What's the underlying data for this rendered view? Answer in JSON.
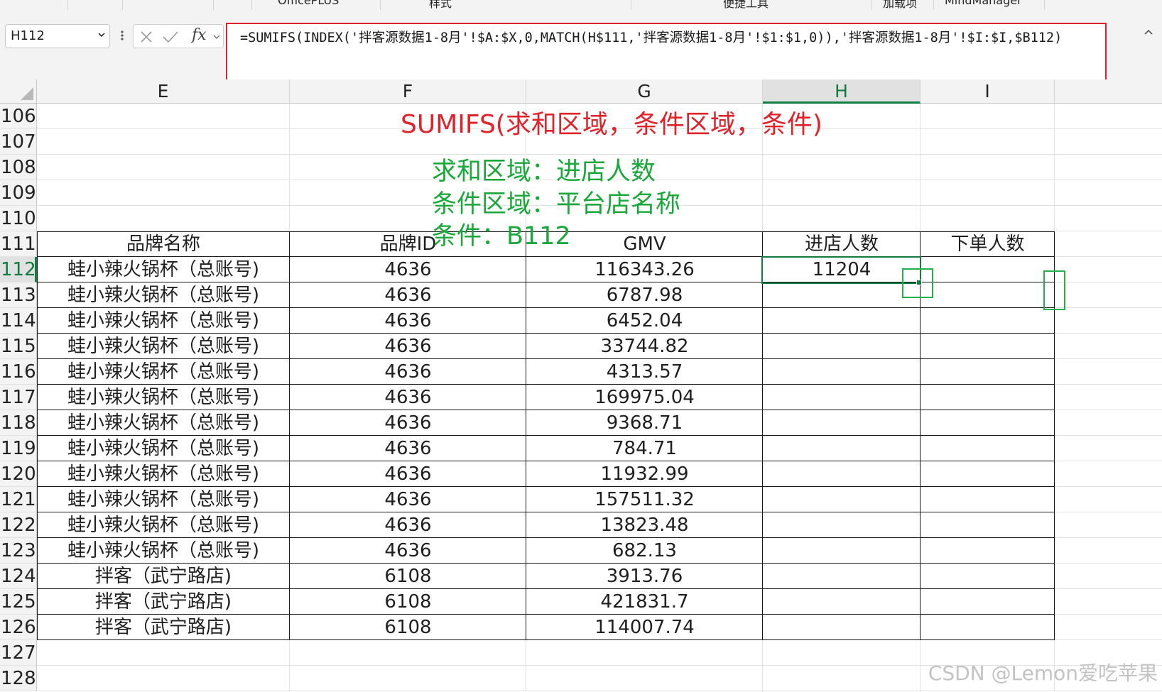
{
  "ribbon": {
    "items": [
      "OfficePLUS",
      "样式",
      "便捷工具",
      "加载项",
      "MindManager"
    ]
  },
  "formula_bar": {
    "name_box": "H112",
    "fx_label": "fx",
    "formula": "=SUMIFS(INDEX('拌客源数据1-8月'!$A:$X,0,MATCH(H$111,'拌客源数据1-8月'!$1:$1,0)),'拌客源数据1-8月'!$I:$I,$B112)"
  },
  "columns": [
    "E",
    "F",
    "G",
    "H",
    "I"
  ],
  "active_column": "H",
  "rows": [
    "106",
    "107",
    "108",
    "109",
    "110",
    "111",
    "112",
    "113",
    "114",
    "115",
    "116",
    "117",
    "118",
    "119",
    "120",
    "121",
    "122",
    "123",
    "124",
    "125",
    "126",
    "127",
    "128"
  ],
  "active_row": "112",
  "annotations": {
    "syntax": "SUMIFS(求和区域，条件区域，条件)",
    "sum_range": "求和区域：进店人数",
    "criteria_range": "条件区域：平台店名称",
    "criteria": "条件：B112"
  },
  "table": {
    "headers": [
      "品牌名称",
      "品牌ID",
      "GMV",
      "进店人数",
      "下单人数"
    ],
    "rows": [
      [
        "蛙小辣火锅杯（总账号)",
        "4636",
        "116343.26",
        "11204",
        ""
      ],
      [
        "蛙小辣火锅杯（总账号)",
        "4636",
        "6787.98",
        "",
        ""
      ],
      [
        "蛙小辣火锅杯（总账号)",
        "4636",
        "6452.04",
        "",
        ""
      ],
      [
        "蛙小辣火锅杯（总账号)",
        "4636",
        "33744.82",
        "",
        ""
      ],
      [
        "蛙小辣火锅杯（总账号)",
        "4636",
        "4313.57",
        "",
        ""
      ],
      [
        "蛙小辣火锅杯（总账号)",
        "4636",
        "169975.04",
        "",
        ""
      ],
      [
        "蛙小辣火锅杯（总账号)",
        "4636",
        "9368.71",
        "",
        ""
      ],
      [
        "蛙小辣火锅杯（总账号)",
        "4636",
        "784.71",
        "",
        ""
      ],
      [
        "蛙小辣火锅杯（总账号)",
        "4636",
        "11932.99",
        "",
        ""
      ],
      [
        "蛙小辣火锅杯（总账号)",
        "4636",
        "157511.32",
        "",
        ""
      ],
      [
        "蛙小辣火锅杯（总账号)",
        "4636",
        "13823.48",
        "",
        ""
      ],
      [
        "蛙小辣火锅杯（总账号)",
        "4636",
        "682.13",
        "",
        ""
      ],
      [
        "拌客（武宁路店)",
        "6108",
        "3913.76",
        "",
        ""
      ],
      [
        "拌客（武宁路店)",
        "6108",
        "421831.7",
        "",
        ""
      ],
      [
        "拌客（武宁路店)",
        "6108",
        "114007.74",
        "",
        ""
      ]
    ]
  },
  "watermark": "CSDN @Lemon爱吃苹果",
  "colors": {
    "accent_green": "#107c41",
    "annotation_red": "#e0232b",
    "annotation_green": "#1aa83a"
  }
}
